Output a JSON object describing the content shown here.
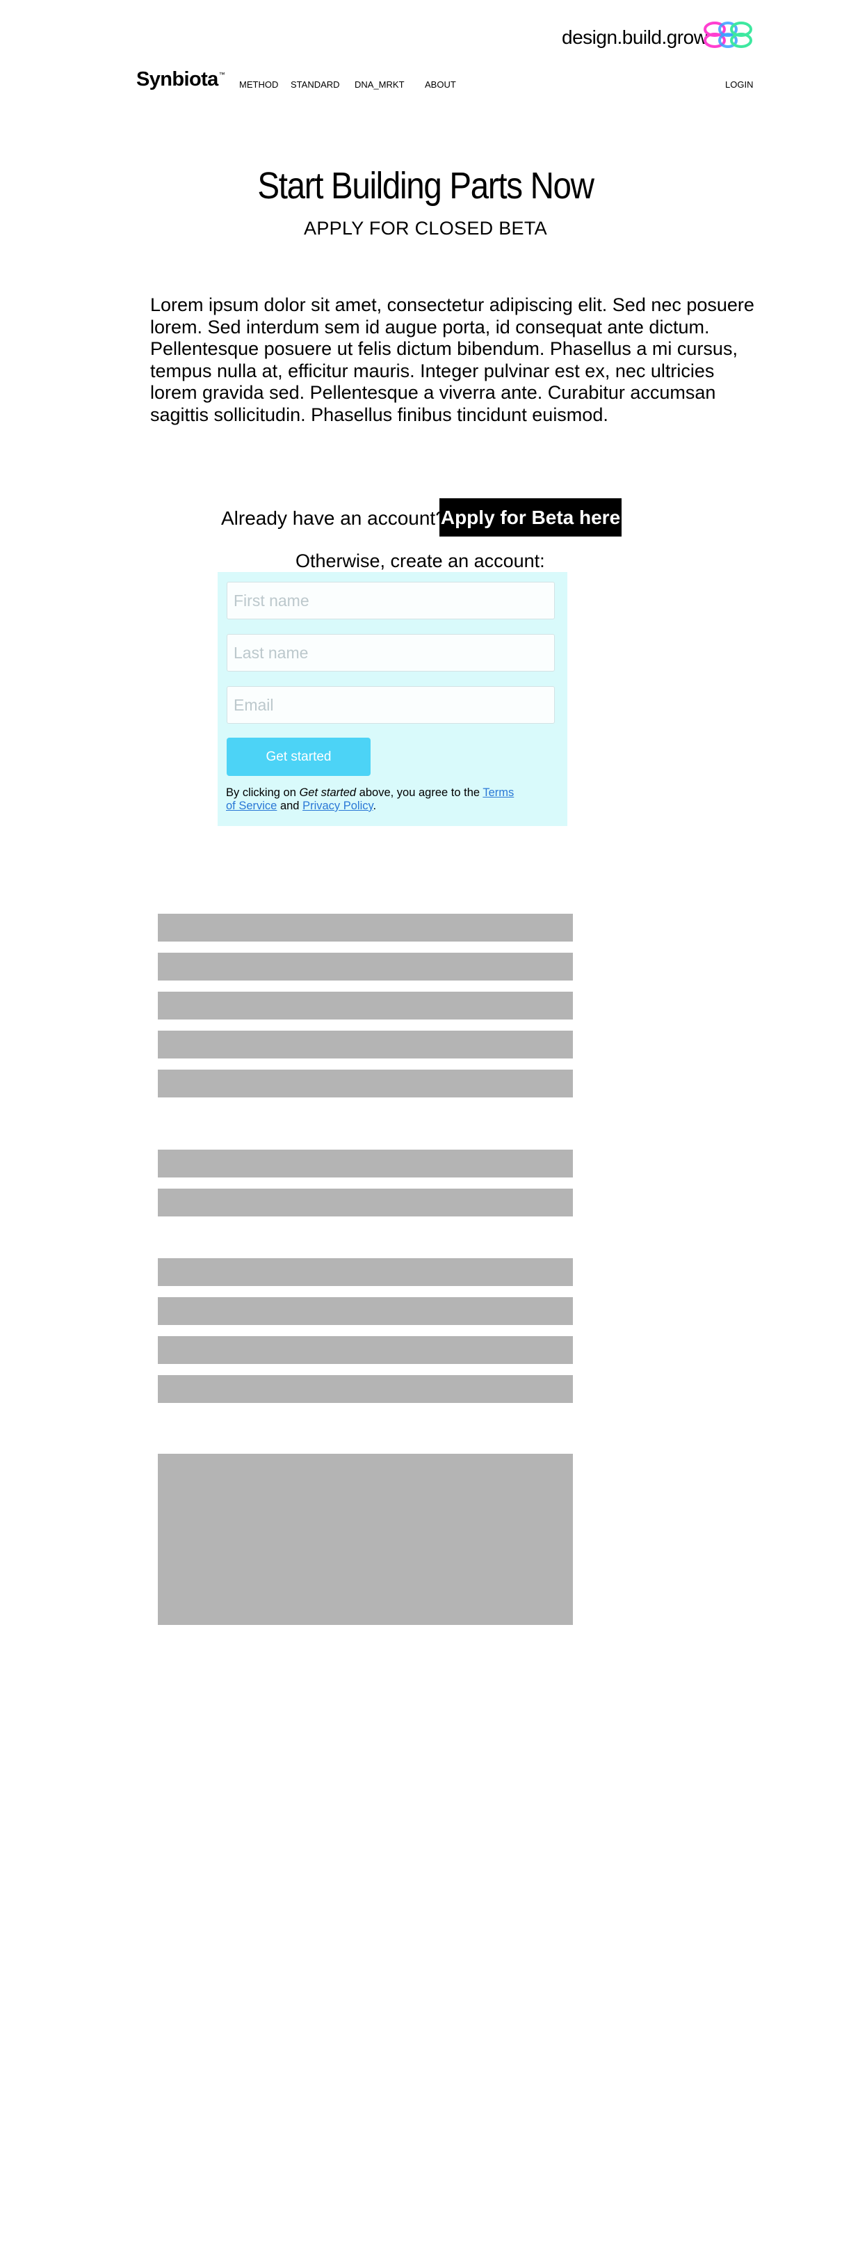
{
  "header": {
    "tagline": "design.build.grow",
    "brand": "Synbiota",
    "brand_mark": "™",
    "nav": [
      "METHOD",
      "STANDARD",
      "DNA_MRKT",
      "ABOUT"
    ],
    "login": "LOGIN"
  },
  "hero": {
    "title": "Start Building Parts Now",
    "subtitle": "APPLY FOR CLOSED BETA"
  },
  "intro": "Lorem ipsum dolor sit amet, consectetur adipiscing elit. Sed nec posuere lorem. Sed interdum sem id augue porta, id consequat ante dictum. Pellentesque posuere ut felis dictum bibendum. Phasellus a mi cursus, tempus nulla at, efficitur mauris. Integer pulvinar est ex, nec ultricies lorem gravida sed. Pellentesque a viverra ante. Curabitur accumsan sagittis sollicitudin. Phasellus finibus tincidunt euismod.",
  "account": {
    "already_text": "Already have an account?",
    "beta_button": "Apply for Beta here",
    "otherwise_text": "Otherwise, create an account:"
  },
  "signup": {
    "first_name_placeholder": "First name",
    "last_name_placeholder": "Last name",
    "email_placeholder": "Email",
    "submit": "Get started",
    "legal_prefix": "By clicking on ",
    "legal_emphasis": "Get started",
    "legal_middle": " above, you agree to the ",
    "terms": "Terms of Service",
    "and": " and ",
    "privacy": "Privacy Policy",
    "period": "."
  },
  "colors": {
    "panel_bg": "#d9fafb",
    "accent": "#4cd3f6",
    "link": "#2a78d6",
    "placeholder_block": "#b4b4b4"
  }
}
